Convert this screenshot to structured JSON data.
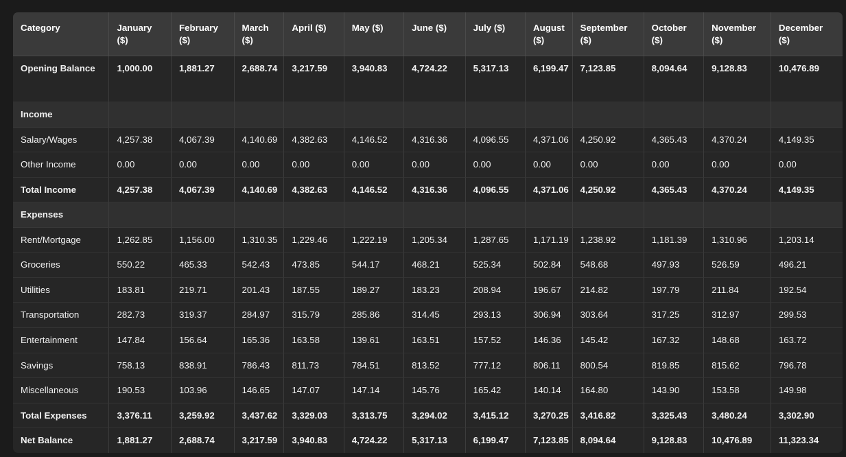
{
  "table": {
    "columns": [
      "Category",
      "January ($)",
      "February ($)",
      "March ($)",
      "April ($)",
      "May ($)",
      "June ($)",
      "July ($)",
      "August ($)",
      "September ($)",
      "October ($)",
      "November ($)",
      "December ($)"
    ],
    "rows": [
      {
        "label": "Opening Balance",
        "kind": "opening",
        "values": [
          "1,000.00",
          "1,881.27",
          "2,688.74",
          "3,217.59",
          "3,940.83",
          "4,724.22",
          "5,317.13",
          "6,199.47",
          "7,123.85",
          "8,094.64",
          "9,128.83",
          "10,476.89"
        ]
      },
      {
        "label": "Income",
        "kind": "section",
        "values": [
          "",
          "",
          "",
          "",
          "",
          "",
          "",
          "",
          "",
          "",
          "",
          ""
        ]
      },
      {
        "label": "Salary/Wages",
        "kind": "data",
        "values": [
          "4,257.38",
          "4,067.39",
          "4,140.69",
          "4,382.63",
          "4,146.52",
          "4,316.36",
          "4,096.55",
          "4,371.06",
          "4,250.92",
          "4,365.43",
          "4,370.24",
          "4,149.35"
        ]
      },
      {
        "label": "Other Income",
        "kind": "data",
        "values": [
          "0.00",
          "0.00",
          "0.00",
          "0.00",
          "0.00",
          "0.00",
          "0.00",
          "0.00",
          "0.00",
          "0.00",
          "0.00",
          "0.00"
        ]
      },
      {
        "label": "Total Income",
        "kind": "total",
        "values": [
          "4,257.38",
          "4,067.39",
          "4,140.69",
          "4,382.63",
          "4,146.52",
          "4,316.36",
          "4,096.55",
          "4,371.06",
          "4,250.92",
          "4,365.43",
          "4,370.24",
          "4,149.35"
        ]
      },
      {
        "label": "Expenses",
        "kind": "section",
        "values": [
          "",
          "",
          "",
          "",
          "",
          "",
          "",
          "",
          "",
          "",
          "",
          ""
        ]
      },
      {
        "label": "Rent/Mortgage",
        "kind": "data",
        "values": [
          "1,262.85",
          "1,156.00",
          "1,310.35",
          "1,229.46",
          "1,222.19",
          "1,205.34",
          "1,287.65",
          "1,171.19",
          "1,238.92",
          "1,181.39",
          "1,310.96",
          "1,203.14"
        ]
      },
      {
        "label": "Groceries",
        "kind": "data",
        "values": [
          "550.22",
          "465.33",
          "542.43",
          "473.85",
          "544.17",
          "468.21",
          "525.34",
          "502.84",
          "548.68",
          "497.93",
          "526.59",
          "496.21"
        ]
      },
      {
        "label": "Utilities",
        "kind": "data",
        "values": [
          "183.81",
          "219.71",
          "201.43",
          "187.55",
          "189.27",
          "183.23",
          "208.94",
          "196.67",
          "214.82",
          "197.79",
          "211.84",
          "192.54"
        ]
      },
      {
        "label": "Transportation",
        "kind": "data",
        "values": [
          "282.73",
          "319.37",
          "284.97",
          "315.79",
          "285.86",
          "314.45",
          "293.13",
          "306.94",
          "303.64",
          "317.25",
          "312.97",
          "299.53"
        ]
      },
      {
        "label": "Entertainment",
        "kind": "data",
        "values": [
          "147.84",
          "156.64",
          "165.36",
          "163.58",
          "139.61",
          "163.51",
          "157.52",
          "146.36",
          "145.42",
          "167.32",
          "148.68",
          "163.72"
        ]
      },
      {
        "label": "Savings",
        "kind": "data",
        "values": [
          "758.13",
          "838.91",
          "786.43",
          "811.73",
          "784.51",
          "813.52",
          "777.12",
          "806.11",
          "800.54",
          "819.85",
          "815.62",
          "796.78"
        ]
      },
      {
        "label": "Miscellaneous",
        "kind": "data",
        "values": [
          "190.53",
          "103.96",
          "146.65",
          "147.07",
          "147.14",
          "145.76",
          "165.42",
          "140.14",
          "164.80",
          "143.90",
          "153.58",
          "149.98"
        ]
      },
      {
        "label": "Total Expenses",
        "kind": "total",
        "values": [
          "3,376.11",
          "3,259.92",
          "3,437.62",
          "3,329.03",
          "3,313.75",
          "3,294.02",
          "3,415.12",
          "3,270.25",
          "3,416.82",
          "3,325.43",
          "3,480.24",
          "3,302.90"
        ]
      },
      {
        "label": "Net Balance",
        "kind": "total",
        "values": [
          "1,881.27",
          "2,688.74",
          "3,217.59",
          "3,940.83",
          "4,724.22",
          "5,317.13",
          "6,199.47",
          "7,123.85",
          "8,094.64",
          "9,128.83",
          "10,476.89",
          "11,323.34"
        ]
      }
    ]
  },
  "theme": {
    "page_background": "#1b1b1b",
    "table_background": "#262626",
    "header_background": "#3a3a3a",
    "section_background": "#303030",
    "text_color": "#f0f0f0",
    "border_color": "#3c3c3c"
  }
}
